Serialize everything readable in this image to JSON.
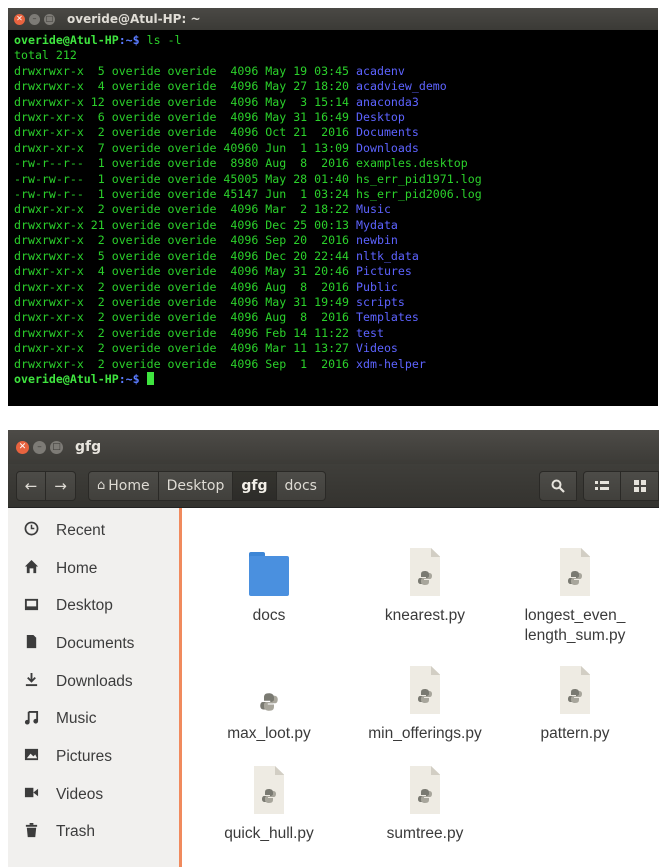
{
  "terminal": {
    "title": "overide@Atul-HP: ~",
    "prompt_user": "overide@Atul-HP",
    "prompt_path": ":~$",
    "command": " ls -l",
    "total": "total 212",
    "rows": [
      {
        "meta": "drwxrwxr-x  5 overide overide  4096 May 19 03:45 ",
        "name": "acadenv",
        "kind": "dir"
      },
      {
        "meta": "drwxrwxr-x  4 overide overide  4096 May 27 18:20 ",
        "name": "acadview_demo",
        "kind": "dir"
      },
      {
        "meta": "drwxrwxr-x 12 overide overide  4096 May  3 15:14 ",
        "name": "anaconda3",
        "kind": "dir"
      },
      {
        "meta": "drwxr-xr-x  6 overide overide  4096 May 31 16:49 ",
        "name": "Desktop",
        "kind": "dir"
      },
      {
        "meta": "drwxr-xr-x  2 overide overide  4096 Oct 21  2016 ",
        "name": "Documents",
        "kind": "dir"
      },
      {
        "meta": "drwxr-xr-x  7 overide overide 40960 Jun  1 13:09 ",
        "name": "Downloads",
        "kind": "dir"
      },
      {
        "meta": "-rw-r--r--  1 overide overide  8980 Aug  8  2016 ",
        "name": "examples.desktop",
        "kind": "file"
      },
      {
        "meta": "-rw-rw-r--  1 overide overide 45005 May 28 01:40 ",
        "name": "hs_err_pid1971.log",
        "kind": "file"
      },
      {
        "meta": "-rw-rw-r--  1 overide overide 45147 Jun  1 03:24 ",
        "name": "hs_err_pid2006.log",
        "kind": "file"
      },
      {
        "meta": "drwxr-xr-x  2 overide overide  4096 Mar  2 18:22 ",
        "name": "Music",
        "kind": "dir"
      },
      {
        "meta": "drwxrwxr-x 21 overide overide  4096 Dec 25 00:13 ",
        "name": "Mydata",
        "kind": "dir"
      },
      {
        "meta": "drwxrwxr-x  2 overide overide  4096 Sep 20  2016 ",
        "name": "newbin",
        "kind": "dir"
      },
      {
        "meta": "drwxrwxr-x  5 overide overide  4096 Dec 20 22:44 ",
        "name": "nltk_data",
        "kind": "dir"
      },
      {
        "meta": "drwxr-xr-x  4 overide overide  4096 May 31 20:46 ",
        "name": "Pictures",
        "kind": "dir"
      },
      {
        "meta": "drwxr-xr-x  2 overide overide  4096 Aug  8  2016 ",
        "name": "Public",
        "kind": "dir"
      },
      {
        "meta": "drwxrwxr-x  2 overide overide  4096 May 31 19:49 ",
        "name": "scripts",
        "kind": "dir"
      },
      {
        "meta": "drwxr-xr-x  2 overide overide  4096 Aug  8  2016 ",
        "name": "Templates",
        "kind": "dir"
      },
      {
        "meta": "drwxrwxr-x  2 overide overide  4096 Feb 14 11:22 ",
        "name": "test",
        "kind": "dir"
      },
      {
        "meta": "drwxr-xr-x  2 overide overide  4096 Mar 11 13:27 ",
        "name": "Videos",
        "kind": "dir"
      },
      {
        "meta": "drwxrwxr-x  2 overide overide  4096 Sep  1  2016 ",
        "name": "xdm-helper",
        "kind": "dir"
      }
    ]
  },
  "file_manager": {
    "title": "gfg",
    "breadcrumbs": [
      {
        "label": "Home",
        "active": false
      },
      {
        "label": "Desktop",
        "active": false
      },
      {
        "label": "gfg",
        "active": true
      },
      {
        "label": "docs",
        "active": false
      }
    ],
    "sidebar": [
      {
        "label": "Recent",
        "icon": "clock-icon"
      },
      {
        "label": "Home",
        "icon": "home-icon"
      },
      {
        "label": "Desktop",
        "icon": "desktop-icon"
      },
      {
        "label": "Documents",
        "icon": "document-icon"
      },
      {
        "label": "Downloads",
        "icon": "download-icon"
      },
      {
        "label": "Music",
        "icon": "music-icon"
      },
      {
        "label": "Pictures",
        "icon": "picture-icon"
      },
      {
        "label": "Videos",
        "icon": "video-icon"
      },
      {
        "label": "Trash",
        "icon": "trash-icon"
      }
    ],
    "files": [
      {
        "name": "docs",
        "type": "folder"
      },
      {
        "name": "knearest.py",
        "type": "python"
      },
      {
        "name": "longest_even_\nlength_sum.py",
        "type": "python"
      },
      {
        "name": "max_loot.py",
        "type": "python-small"
      },
      {
        "name": "min_offerings.py",
        "type": "python"
      },
      {
        "name": "pattern.py",
        "type": "python"
      },
      {
        "name": "quick_hull.py",
        "type": "python"
      },
      {
        "name": "sumtree.py",
        "type": "python"
      }
    ]
  },
  "colors": {
    "terminal_green": "#2bd12b",
    "terminal_blue": "#5d63ff",
    "sidebar_accent": "#f08a5d",
    "folder_blue": "#4a90df"
  }
}
